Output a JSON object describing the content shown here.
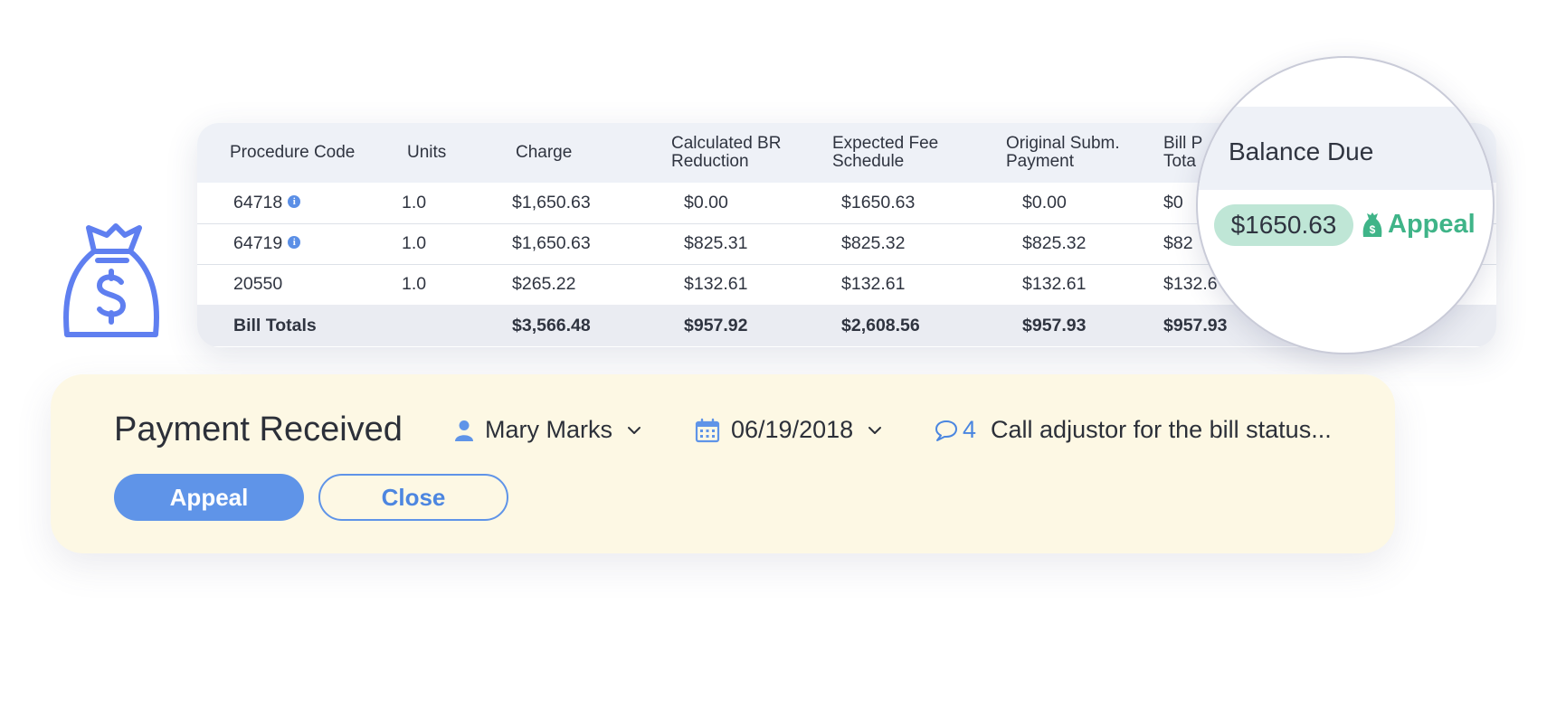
{
  "colors": {
    "accent_blue": "#5f94e8",
    "green": "#3fb488",
    "pill_green": "#bfe6d6",
    "panel_bg": "#fdf8e4",
    "header_bg": "#eef1f7"
  },
  "icons": [
    "money-bag-icon",
    "info-icon",
    "user-icon",
    "calendar-icon",
    "chevron-down-icon",
    "comment-icon",
    "money-bag-small-icon"
  ],
  "table": {
    "headers": [
      [
        "Procedure Code"
      ],
      [
        "Units"
      ],
      [
        "Charge"
      ],
      [
        "Calculated BR",
        "Reduction"
      ],
      [
        "Expected Fee",
        "Schedule"
      ],
      [
        "Original Subm.",
        "Payment"
      ],
      [
        "Bill P",
        "Tota"
      ]
    ],
    "rows": [
      {
        "code": "64718",
        "info": true,
        "units": "1.0",
        "charge": "$1,650.63",
        "br_reduction": "$0.00",
        "fee_schedule": "$1650.63",
        "orig_payment": "$0.00",
        "bill_total": "$0"
      },
      {
        "code": "64719",
        "info": true,
        "units": "1.0",
        "charge": "$1,650.63",
        "br_reduction": "$825.31",
        "fee_schedule": "$825.32",
        "orig_payment": "$825.32",
        "bill_total": "$82"
      },
      {
        "code": "20550",
        "info": false,
        "units": "1.0",
        "charge": "$265.22",
        "br_reduction": "$132.61",
        "fee_schedule": "$132.61",
        "orig_payment": "$132.61",
        "bill_total": "$132.6"
      }
    ],
    "totals": {
      "label": "Bill Totals",
      "charge": "$3,566.48",
      "br_reduction": "$957.92",
      "fee_schedule": "$2,608.56",
      "orig_payment": "$957.93",
      "bill_total": "$957.93"
    }
  },
  "magnifier": {
    "title": "Balance Due",
    "balance": "$1650.63",
    "appeal_label": "Appeal"
  },
  "payment": {
    "title": "Payment Received",
    "assignee": "Mary Marks",
    "date": "06/19/2018",
    "comment_count": "4",
    "comment_text": "Call adjustor for the bill status...",
    "appeal_button": "Appeal",
    "close_button": "Close"
  }
}
